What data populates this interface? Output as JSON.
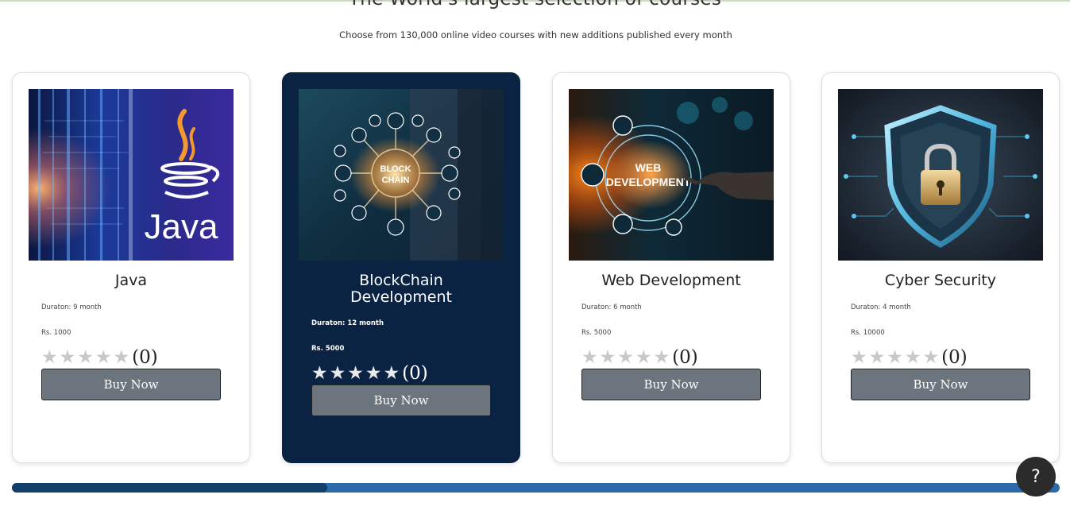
{
  "section": {
    "title": "The World's largest selection of courses",
    "subtitle": "Choose from 130,000 online video courses with new additions published every month"
  },
  "image_captions": {
    "java": "Java",
    "blockchain_line1": "BLOCK",
    "blockchain_line2": "CHAIN",
    "web_line1": "WEB",
    "web_line2": "DEVELOPMENT"
  },
  "courses": [
    {
      "title": "Java",
      "duration": "Duraton: 9 month",
      "price": "Rs. 1000",
      "rating_count": "(0)",
      "rating": 0,
      "button": "Buy Now",
      "image_icon": "java-logo-image"
    },
    {
      "title": "BlockChain Development",
      "duration": "Duraton: 12 month",
      "price": "Rs. 5000",
      "rating_count": "(0)",
      "rating": 0,
      "button": "Buy Now",
      "image_icon": "blockchain-network-image"
    },
    {
      "title": "Web Development",
      "duration": "Duraton: 6 month",
      "price": "Rs. 5000",
      "rating_count": "(0)",
      "rating": 0,
      "button": "Buy Now",
      "image_icon": "web-development-image"
    },
    {
      "title": "Cyber Security",
      "duration": "Duraton: 4 month",
      "price": "Rs. 10000",
      "rating_count": "(0)",
      "rating": 0,
      "button": "Buy Now",
      "image_icon": "security-shield-lock-image"
    }
  ],
  "help_button": {
    "label": "?"
  },
  "scrollbar": {
    "position": 0.3
  },
  "colors": {
    "featured_card": "#0a2342",
    "button": "#6c757d",
    "scroll_track": "#2c6bab",
    "scroll_thumb": "#12406b",
    "help_button": "#2b2b2b"
  }
}
